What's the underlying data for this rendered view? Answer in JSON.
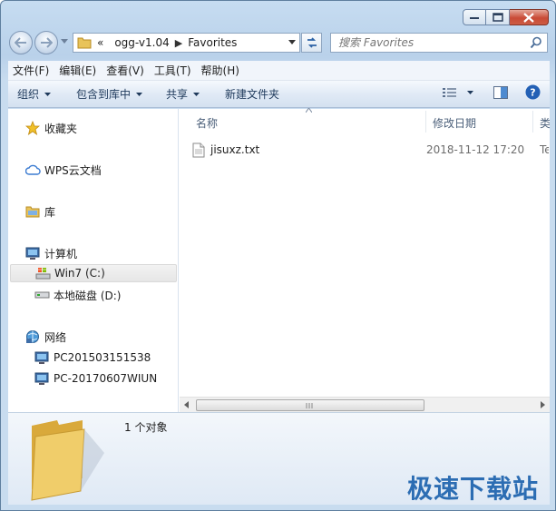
{
  "address": {
    "chevrons": "«",
    "crumbs": [
      "ogg-v1.04",
      "Favorites"
    ]
  },
  "search": {
    "placeholder": "搜索 Favorites"
  },
  "menu": [
    "文件(F)",
    "编辑(E)",
    "查看(V)",
    "工具(T)",
    "帮助(H)"
  ],
  "commands": {
    "organize": "组织",
    "include_in_library": "包含到库中",
    "share": "共享",
    "new_folder": "新建文件夹"
  },
  "nav": {
    "favorites": "收藏夹",
    "wps_cloud": "WPS云文档",
    "library": "库",
    "computer": "计算机",
    "drive_c": "Win7 (C:)",
    "drive_d": "本地磁盘 (D:)",
    "network": "网络",
    "pc1": "PC201503151538",
    "pc2": "PC-20170607WIUN"
  },
  "columns": {
    "name": "名称",
    "date": "修改日期",
    "type": "类"
  },
  "files": [
    {
      "name": "jisuxz.txt",
      "date": "2018-11-12 17:20",
      "type": "Te"
    }
  ],
  "details": {
    "count": "1 个对象"
  },
  "watermark": "极速下载站",
  "icons": {
    "back": "back-arrow-icon",
    "forward": "forward-arrow-icon",
    "refresh": "refresh-icon",
    "search": "search-icon",
    "view": "view-options-icon",
    "preview": "preview-pane-icon",
    "help": "help-icon"
  },
  "colors": {
    "accent": "#2c6db3",
    "close": "#c94b36",
    "selection": "#e6e6e6"
  }
}
